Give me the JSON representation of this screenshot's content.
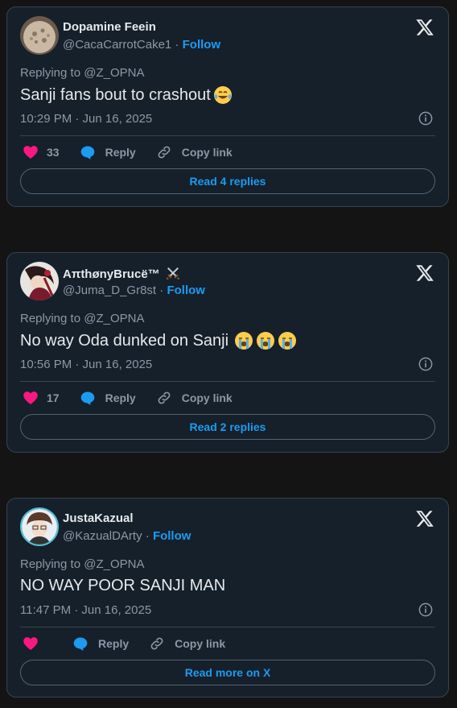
{
  "tweets": [
    {
      "display_name": "Dopamine Feein",
      "handle": "@CacaCarrotCake1",
      "separator": " · ",
      "follow_label": "Follow",
      "replying_to": "Replying to @Z_OPNA",
      "text": "Sanji fans bout to crashout",
      "emojis": [
        "face-with-tears-of-joy"
      ],
      "timestamp": "10:29 PM · Jun 16, 2025",
      "like_count": "33",
      "reply_label": "Reply",
      "copy_link_label": "Copy link",
      "read_button_label": "Read 4 replies"
    },
    {
      "display_name": "AπthønyBrucë™",
      "name_emoji": "crossed-swords",
      "handle": "@Juma_D_Gr8st",
      "separator": " · ",
      "follow_label": "Follow",
      "replying_to": "Replying to @Z_OPNA",
      "text": "No way Oda dunked on Sanji",
      "emojis": [
        "loudly-crying-face",
        "loudly-crying-face",
        "loudly-crying-face"
      ],
      "timestamp": "10:56 PM · Jun 16, 2025",
      "like_count": "17",
      "reply_label": "Reply",
      "copy_link_label": "Copy link",
      "read_button_label": "Read 2 replies"
    },
    {
      "display_name": "JustaKazual",
      "handle": "@KazualDArty",
      "separator": " · ",
      "follow_label": "Follow",
      "replying_to": "Replying to @Z_OPNA",
      "text": "NO WAY POOR SANJI MAN",
      "emojis": [],
      "timestamp": "11:47 PM · Jun 16, 2025",
      "like_count": "",
      "reply_label": "Reply",
      "copy_link_label": "Copy link",
      "read_button_label": "Read more on X"
    }
  ],
  "colors": {
    "card_bg": "#15202b",
    "border": "#38444d",
    "accent": "#1d9bf0",
    "like": "#f91880",
    "muted": "#8b98a5",
    "text": "#e7e9ea"
  }
}
